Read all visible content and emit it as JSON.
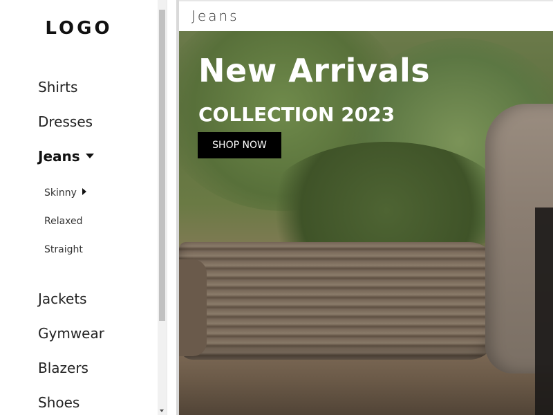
{
  "logo": {
    "text": "LOGO"
  },
  "sidebar": {
    "items": [
      {
        "label": "Shirts"
      },
      {
        "label": "Dresses"
      },
      {
        "label": "Jeans"
      },
      {
        "label": "Jackets"
      },
      {
        "label": "Gymwear"
      },
      {
        "label": "Blazers"
      },
      {
        "label": "Shoes"
      }
    ],
    "active_index": 2,
    "subitems": [
      {
        "label": "Skinny"
      },
      {
        "label": "Relaxed"
      },
      {
        "label": "Straight"
      }
    ]
  },
  "header": {
    "title": "Jeans"
  },
  "hero": {
    "title": "New Arrivals",
    "subtitle": "COLLECTION 2023",
    "cta_label": "SHOP NOW"
  },
  "icons": {
    "caret_down": "caret-down-icon",
    "caret_right": "caret-right-icon",
    "scroll_arrow": "scroll-down-arrow-icon"
  },
  "colors": {
    "button_bg": "#000000",
    "button_text": "#ffffff",
    "hero_text": "#ffffff"
  }
}
